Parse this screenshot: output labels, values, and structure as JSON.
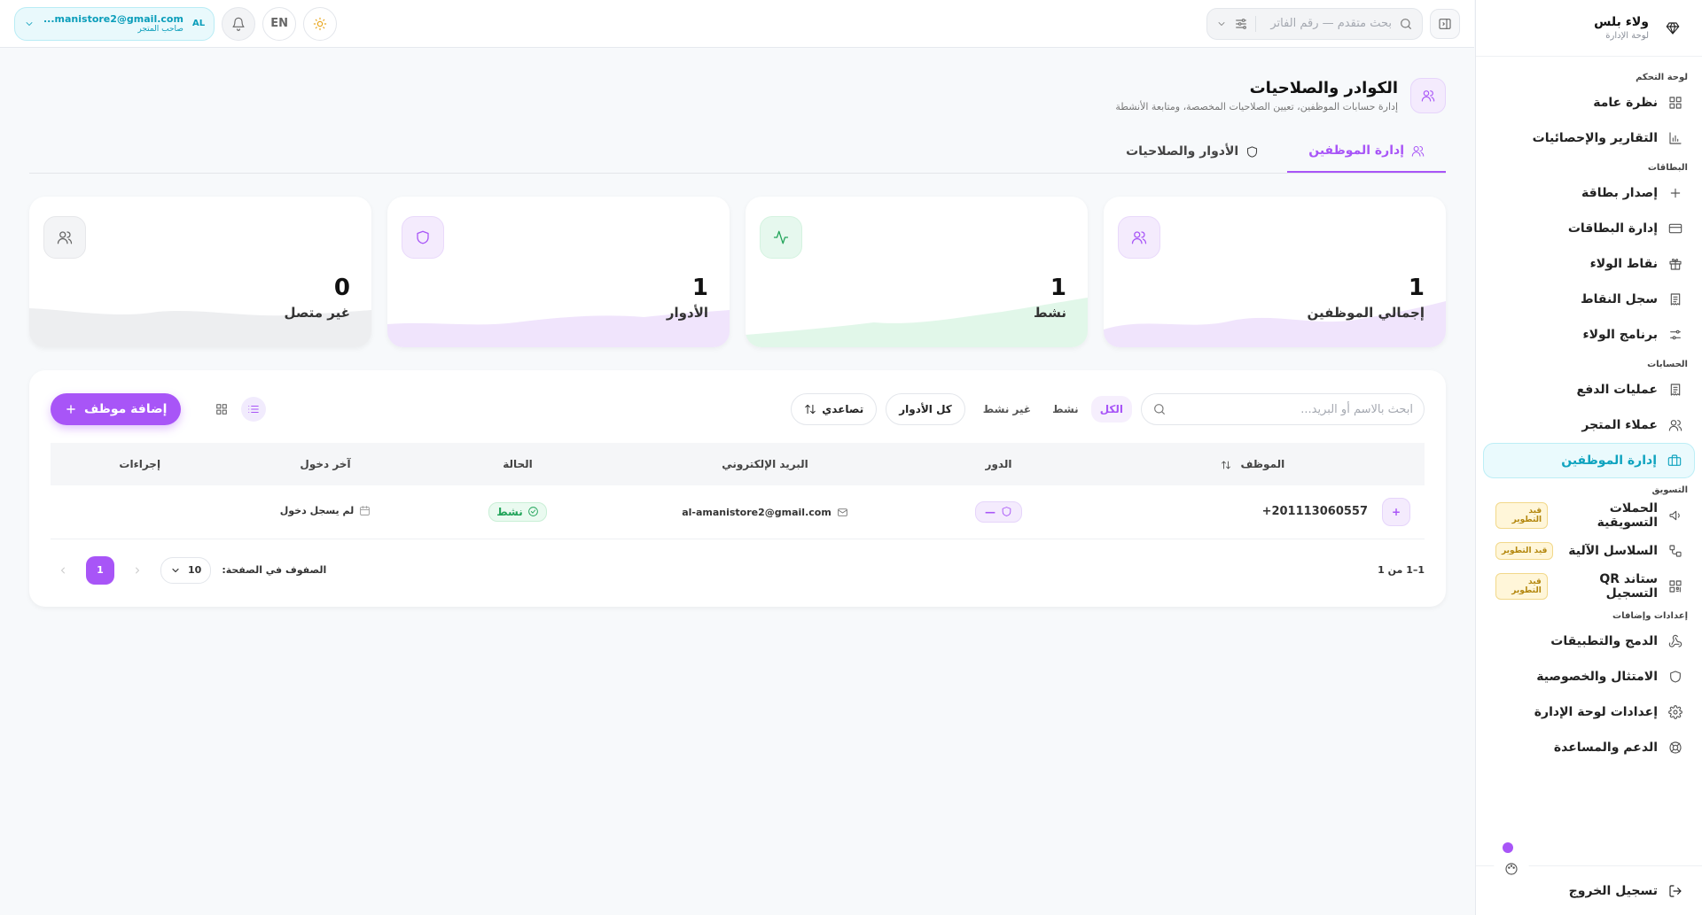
{
  "brand": {
    "name": "ولاء بلس",
    "subtitle": "لوحة الإدارة"
  },
  "sidebar": {
    "sections": [
      {
        "title": "لوحة التحكم",
        "items": [
          {
            "label": "نظرة عامة",
            "icon": "grid-icon"
          },
          {
            "label": "التقارير والإحصائيات",
            "icon": "bar-chart-icon"
          }
        ]
      },
      {
        "title": "البطاقات",
        "items": [
          {
            "label": "إصدار بطاقة",
            "icon": "plus-icon"
          },
          {
            "label": "إدارة البطاقات",
            "icon": "card-icon"
          },
          {
            "label": "نقاط الولاء",
            "icon": "gift-icon"
          },
          {
            "label": "سجل النقاط",
            "icon": "receipt-icon"
          },
          {
            "label": "برنامج الولاء",
            "icon": "sliders-icon"
          }
        ]
      },
      {
        "title": "الحسابات",
        "items": [
          {
            "label": "عمليات الدفع",
            "icon": "receipt-icon"
          },
          {
            "label": "عملاء المتجر",
            "icon": "users-icon"
          },
          {
            "label": "إدارة الموظفين",
            "icon": "briefcase-icon",
            "active": true
          }
        ]
      },
      {
        "title": "التسويق",
        "items": [
          {
            "label": "الحملات التسويقية",
            "icon": "megaphone-icon",
            "badge": "قيد التطوير"
          },
          {
            "label": "السلاسل الآلية",
            "icon": "workflow-icon",
            "badge": "قيد التطوير"
          },
          {
            "label": "ستاند QR التسجيل",
            "icon": "qr-icon",
            "badge": "قيد التطوير"
          }
        ]
      },
      {
        "title": "إعدادات وإضافات",
        "items": [
          {
            "label": "الدمج والتطبيقات",
            "icon": "webhook-icon"
          },
          {
            "label": "الامتثال والخصوصية",
            "icon": "shield-icon"
          },
          {
            "label": "إعدادات لوحة الإدارة",
            "icon": "gear-icon"
          },
          {
            "label": "الدعم والمساعدة",
            "icon": "lifebuoy-icon"
          }
        ]
      }
    ],
    "logout": "تسجيل الخروج"
  },
  "topbar": {
    "search_placeholder": "بحث متقدم — رقم الفاتر",
    "language": "EN",
    "user": {
      "email": "...manistore2@gmail.com",
      "role": "صاحب المتجر",
      "initials": "AL"
    }
  },
  "page": {
    "title": "الكوادر والصلاحيات",
    "subtitle": "إدارة حسابات الموظفين، تعيين الصلاحيات المخصصة، ومتابعة الأنشطة",
    "tabs": [
      {
        "label": "إدارة الموظفين",
        "icon": "users-icon",
        "active": true
      },
      {
        "label": "الأدوار والصلاحيات",
        "icon": "shield-icon",
        "active": false
      }
    ]
  },
  "stats": [
    {
      "label": "إجمالي الموظفين",
      "value": "1",
      "icon": "users-icon",
      "color": "#a855f7",
      "bg": "#f4ebfd",
      "wave": "#e9d9fb"
    },
    {
      "label": "نشط",
      "value": "1",
      "icon": "activity-icon",
      "color": "#22a45a",
      "bg": "#e6f8ee",
      "wave": "#d4f3e0"
    },
    {
      "label": "الأدوار",
      "value": "1",
      "icon": "shield-icon",
      "color": "#a855f7",
      "bg": "#f4ebfd",
      "wave": "#e9d9fb"
    },
    {
      "label": "غير متصل",
      "value": "0",
      "icon": "users-icon",
      "color": "#666666",
      "bg": "#f3f4f6",
      "wave": "#e6e7ea"
    }
  ],
  "toolbar": {
    "search_placeholder": "ابحث بالاسم أو البريد...",
    "filters": [
      "الكل",
      "نشط",
      "غير نشط"
    ],
    "active_filter": "الكل",
    "roles_button": "كل الأدوار",
    "sort_button": "تصاعدي",
    "add_button": "إضافة موظف"
  },
  "table": {
    "columns": [
      "الموظف",
      "الدور",
      "البريد الإلكتروني",
      "الحالة",
      "آخر دخول",
      "إجراءات"
    ],
    "rows": [
      {
        "employee": "+201113060557",
        "role": "—",
        "email": "al-amanistore2@gmail.com",
        "status": "نشط",
        "last_login": "لم يسجل دخول",
        "actions": ""
      }
    ]
  },
  "pagination": {
    "summary": "1–1 من 1",
    "rows_label": "الصفوف في الصفحة:",
    "rows_value": "10",
    "current_page": "1"
  },
  "colors": {
    "accent": "#a855f7",
    "active_nav": "#0fa3bf",
    "success": "#22a45a"
  }
}
